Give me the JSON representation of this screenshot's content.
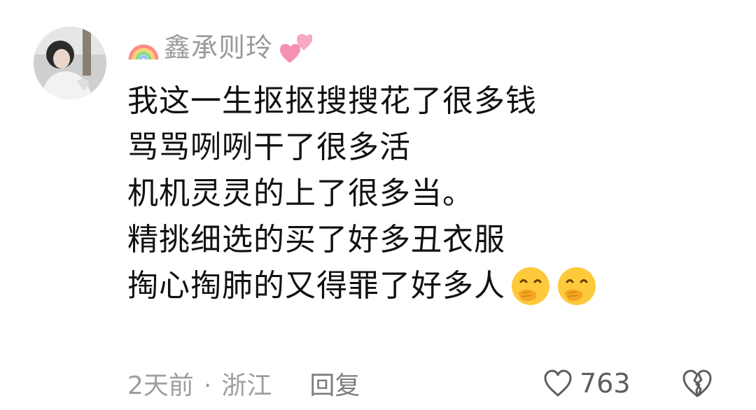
{
  "comment": {
    "username": "鑫承则玲",
    "username_prefix_icon": "rainbow-icon",
    "username_suffix_icon": "two-hearts-icon",
    "lines": [
      "我这一生抠抠搜搜花了很多钱",
      "骂骂咧咧干了很多活",
      "机机灵灵的上了很多当。",
      "精挑细选的买了好多丑衣服",
      "掏心掏肺的又得罪了好多人"
    ],
    "trailing_emojis": [
      "face-with-hand-over-mouth-icon",
      "face-with-hand-over-mouth-icon"
    ],
    "time": "2天前",
    "separator": "·",
    "location": "浙江",
    "reply_label": "回复",
    "like_count": "763",
    "like_icon": "heart-outline-icon",
    "dislike_icon": "broken-heart-icon"
  }
}
